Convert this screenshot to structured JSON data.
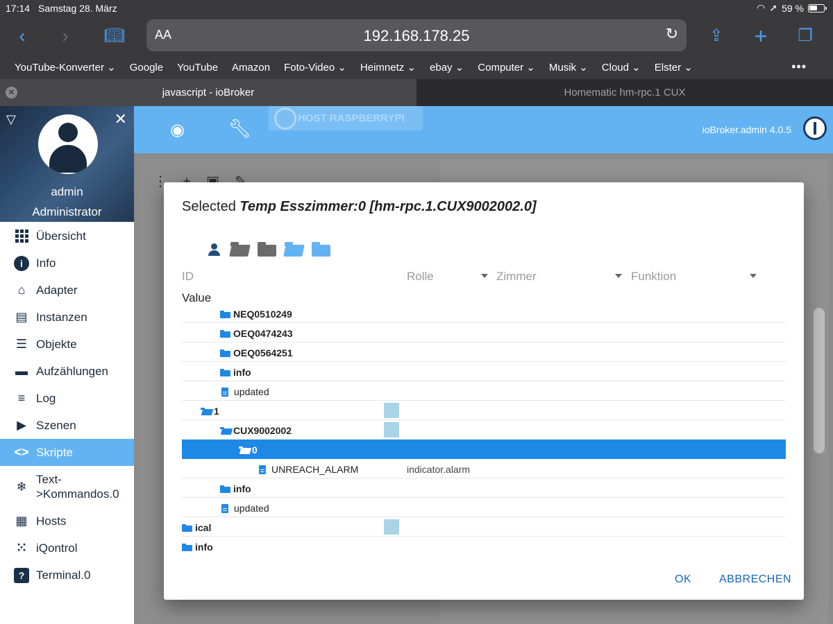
{
  "status": {
    "time": "17:14",
    "date": "Samstag 28. März",
    "battery": "59 %"
  },
  "browser": {
    "aa": "AA",
    "url": "192.168.178.25"
  },
  "bookmarks": [
    "YouTube-Konverter ⌄",
    "Google",
    "YouTube",
    "Amazon",
    "Foto-Video ⌄",
    "Heimnetz ⌄",
    "ebay ⌄",
    "Computer ⌄",
    "Musik ⌄",
    "Cloud ⌄",
    "Elster ⌄"
  ],
  "tabs": {
    "active": "javascript - ioBroker",
    "inactive": "Homematic hm-rpc.1 CUX"
  },
  "profile": {
    "name": "admin",
    "role": "Administrator"
  },
  "menu": [
    "Übersicht",
    "Info",
    "Adapter",
    "Instanzen",
    "Objekte",
    "Aufzählungen",
    "Log",
    "Szenen",
    "Skripte",
    "Text-\n>Kommandos.0",
    "Hosts",
    "iQontrol",
    "Terminal.0"
  ],
  "appbar": {
    "host": "HOST RASPBERRYPI",
    "version": "ioBroker.admin 4.0.5"
  },
  "dialog": {
    "title_prefix": "Selected ",
    "title_selected": "Temp Esszimmer:0 [hm-rpc.1.CUX9002002.0]",
    "columns": {
      "id": "ID",
      "rolle": "Rolle",
      "zimmer": "Zimmer",
      "funktion": "Funktion"
    },
    "value_label": "Value",
    "rows": [
      {
        "label": "NEQ0510249",
        "type": "folder",
        "bold": true
      },
      {
        "label": "OEQ0474243",
        "type": "folder",
        "bold": true
      },
      {
        "label": "OEQ0564251",
        "type": "folder",
        "bold": true
      },
      {
        "label": "info",
        "type": "folder",
        "bold": true
      },
      {
        "label": "updated",
        "type": "doc",
        "bold": false
      },
      {
        "label": "1",
        "type": "folder-open",
        "bold": true
      },
      {
        "label": "CUX9002002",
        "type": "folder-open",
        "bold": true
      },
      {
        "label": "0",
        "type": "folder-open",
        "bold": true
      },
      {
        "label": "UNREACH_ALARM",
        "type": "doc",
        "bold": false,
        "role": "indicator.alarm"
      },
      {
        "label": "info",
        "type": "folder",
        "bold": true
      },
      {
        "label": "updated",
        "type": "doc",
        "bold": false
      },
      {
        "label": "ical",
        "type": "folder",
        "bold": true
      },
      {
        "label": "info",
        "type": "folder",
        "bold": true
      }
    ],
    "ok": "OK",
    "cancel": "ABBRECHEN"
  },
  "colors": {
    "accent": "#63b3f2",
    "selected": "#1e88e5",
    "dark": "#1a3048"
  }
}
